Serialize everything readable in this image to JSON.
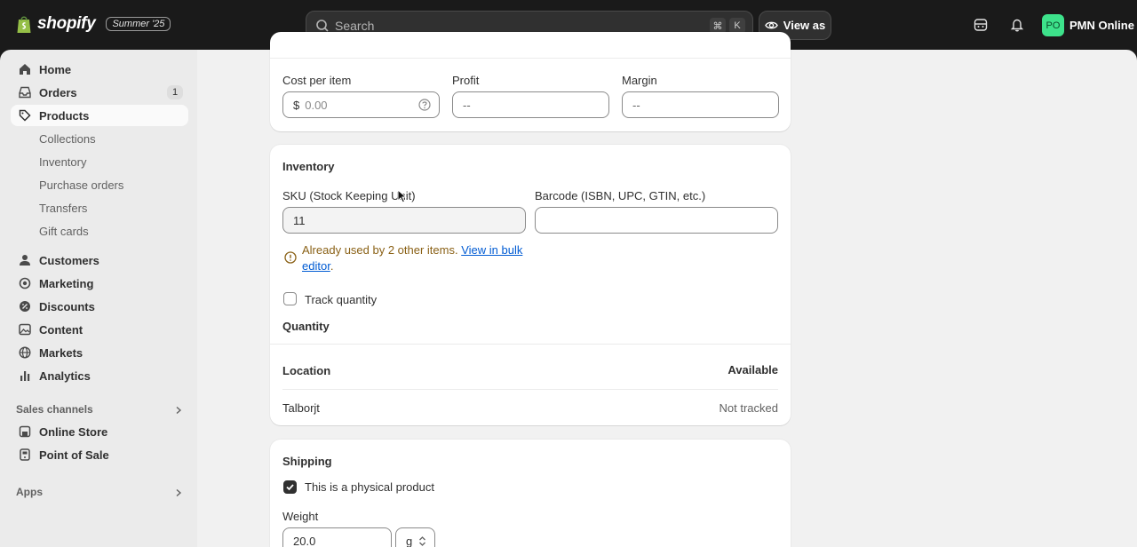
{
  "topbar": {
    "brand": "shopify",
    "edition": "Summer '25",
    "search_placeholder": "Search",
    "kbd_1": "⌘",
    "kbd_2": "K",
    "view_as": "View as",
    "store_initials": "PO",
    "store_name": "PMN Online"
  },
  "sidebar": {
    "home": "Home",
    "orders": "Orders",
    "orders_badge": "1",
    "products": "Products",
    "collections": "Collections",
    "inventory": "Inventory",
    "purchase_orders": "Purchase orders",
    "transfers": "Transfers",
    "gift_cards": "Gift cards",
    "customers": "Customers",
    "marketing": "Marketing",
    "discounts": "Discounts",
    "content": "Content",
    "markets": "Markets",
    "analytics": "Analytics",
    "sales_channels": "Sales channels",
    "online_store": "Online Store",
    "point_of_sale": "Point of Sale",
    "apps": "Apps"
  },
  "pricing": {
    "cost_label": "Cost per item",
    "cost_prefix": "$",
    "cost_placeholder": "0.00",
    "profit_label": "Profit",
    "profit_value": "--",
    "margin_label": "Margin",
    "margin_value": "--"
  },
  "inventory": {
    "title": "Inventory",
    "sku_label": "SKU (Stock Keeping Unit)",
    "sku_value": "11",
    "barcode_label": "Barcode (ISBN, UPC, GTIN, etc.)",
    "barcode_value": "",
    "warning_text": "Already used by 2 other items.",
    "warning_link_1": "View in bulk",
    "warning_link_2": "editor",
    "warning_end": ".",
    "track_label": "Track quantity",
    "quantity_title": "Quantity",
    "location_header": "Location",
    "available_header": "Available",
    "location_name": "Talborjt",
    "location_status": "Not tracked"
  },
  "shipping": {
    "title": "Shipping",
    "physical_label": "This is a physical product",
    "weight_label": "Weight",
    "weight_value": "20.0",
    "weight_unit": "g"
  },
  "colors": {
    "accent": "#005bd3",
    "warning": "#8a6116",
    "avatar": "#3de28b"
  }
}
